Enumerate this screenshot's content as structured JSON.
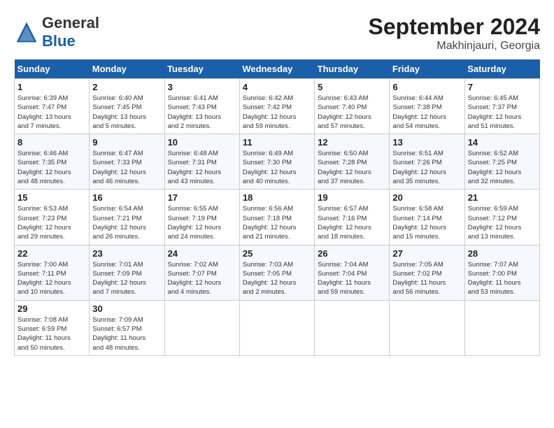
{
  "header": {
    "logo_text_general": "General",
    "logo_text_blue": "Blue",
    "month": "September 2024",
    "location": "Makhinjauri, Georgia"
  },
  "weekdays": [
    "Sunday",
    "Monday",
    "Tuesday",
    "Wednesday",
    "Thursday",
    "Friday",
    "Saturday"
  ],
  "weeks": [
    [
      {
        "day": "1",
        "info": "Sunrise: 6:39 AM\nSunset: 7:47 PM\nDaylight: 13 hours\nand 7 minutes."
      },
      {
        "day": "2",
        "info": "Sunrise: 6:40 AM\nSunset: 7:45 PM\nDaylight: 13 hours\nand 5 minutes."
      },
      {
        "day": "3",
        "info": "Sunrise: 6:41 AM\nSunset: 7:43 PM\nDaylight: 13 hours\nand 2 minutes."
      },
      {
        "day": "4",
        "info": "Sunrise: 6:42 AM\nSunset: 7:42 PM\nDaylight: 12 hours\nand 59 minutes."
      },
      {
        "day": "5",
        "info": "Sunrise: 6:43 AM\nSunset: 7:40 PM\nDaylight: 12 hours\nand 57 minutes."
      },
      {
        "day": "6",
        "info": "Sunrise: 6:44 AM\nSunset: 7:38 PM\nDaylight: 12 hours\nand 54 minutes."
      },
      {
        "day": "7",
        "info": "Sunrise: 6:45 AM\nSunset: 7:37 PM\nDaylight: 12 hours\nand 51 minutes."
      }
    ],
    [
      {
        "day": "8",
        "info": "Sunrise: 6:46 AM\nSunset: 7:35 PM\nDaylight: 12 hours\nand 48 minutes."
      },
      {
        "day": "9",
        "info": "Sunrise: 6:47 AM\nSunset: 7:33 PM\nDaylight: 12 hours\nand 46 minutes."
      },
      {
        "day": "10",
        "info": "Sunrise: 6:48 AM\nSunset: 7:31 PM\nDaylight: 12 hours\nand 43 minutes."
      },
      {
        "day": "11",
        "info": "Sunrise: 6:49 AM\nSunset: 7:30 PM\nDaylight: 12 hours\nand 40 minutes."
      },
      {
        "day": "12",
        "info": "Sunrise: 6:50 AM\nSunset: 7:28 PM\nDaylight: 12 hours\nand 37 minutes."
      },
      {
        "day": "13",
        "info": "Sunrise: 6:51 AM\nSunset: 7:26 PM\nDaylight: 12 hours\nand 35 minutes."
      },
      {
        "day": "14",
        "info": "Sunrise: 6:52 AM\nSunset: 7:25 PM\nDaylight: 12 hours\nand 32 minutes."
      }
    ],
    [
      {
        "day": "15",
        "info": "Sunrise: 6:53 AM\nSunset: 7:23 PM\nDaylight: 12 hours\nand 29 minutes."
      },
      {
        "day": "16",
        "info": "Sunrise: 6:54 AM\nSunset: 7:21 PM\nDaylight: 12 hours\nand 26 minutes."
      },
      {
        "day": "17",
        "info": "Sunrise: 6:55 AM\nSunset: 7:19 PM\nDaylight: 12 hours\nand 24 minutes."
      },
      {
        "day": "18",
        "info": "Sunrise: 6:56 AM\nSunset: 7:18 PM\nDaylight: 12 hours\nand 21 minutes."
      },
      {
        "day": "19",
        "info": "Sunrise: 6:57 AM\nSunset: 7:16 PM\nDaylight: 12 hours\nand 18 minutes."
      },
      {
        "day": "20",
        "info": "Sunrise: 6:58 AM\nSunset: 7:14 PM\nDaylight: 12 hours\nand 15 minutes."
      },
      {
        "day": "21",
        "info": "Sunrise: 6:59 AM\nSunset: 7:12 PM\nDaylight: 12 hours\nand 13 minutes."
      }
    ],
    [
      {
        "day": "22",
        "info": "Sunrise: 7:00 AM\nSunset: 7:11 PM\nDaylight: 12 hours\nand 10 minutes."
      },
      {
        "day": "23",
        "info": "Sunrise: 7:01 AM\nSunset: 7:09 PM\nDaylight: 12 hours\nand 7 minutes."
      },
      {
        "day": "24",
        "info": "Sunrise: 7:02 AM\nSunset: 7:07 PM\nDaylight: 12 hours\nand 4 minutes."
      },
      {
        "day": "25",
        "info": "Sunrise: 7:03 AM\nSunset: 7:05 PM\nDaylight: 12 hours\nand 2 minutes."
      },
      {
        "day": "26",
        "info": "Sunrise: 7:04 AM\nSunset: 7:04 PM\nDaylight: 11 hours\nand 59 minutes."
      },
      {
        "day": "27",
        "info": "Sunrise: 7:05 AM\nSunset: 7:02 PM\nDaylight: 11 hours\nand 56 minutes."
      },
      {
        "day": "28",
        "info": "Sunrise: 7:07 AM\nSunset: 7:00 PM\nDaylight: 11 hours\nand 53 minutes."
      }
    ],
    [
      {
        "day": "29",
        "info": "Sunrise: 7:08 AM\nSunset: 6:59 PM\nDaylight: 11 hours\nand 50 minutes."
      },
      {
        "day": "30",
        "info": "Sunrise: 7:09 AM\nSunset: 6:57 PM\nDaylight: 11 hours\nand 48 minutes."
      },
      {
        "day": "",
        "info": ""
      },
      {
        "day": "",
        "info": ""
      },
      {
        "day": "",
        "info": ""
      },
      {
        "day": "",
        "info": ""
      },
      {
        "day": "",
        "info": ""
      }
    ]
  ]
}
